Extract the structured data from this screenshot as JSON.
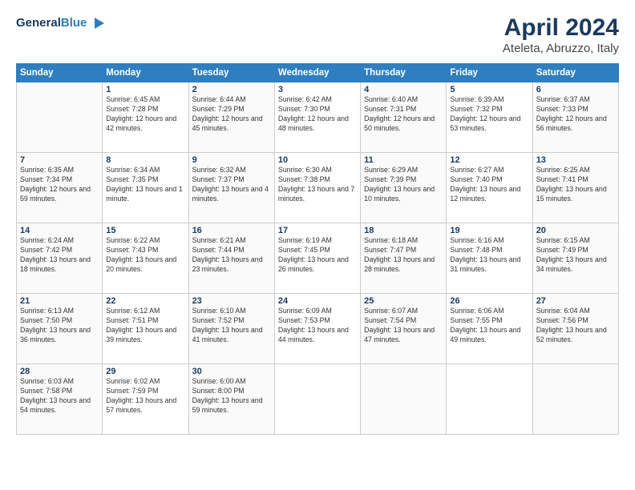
{
  "logo": {
    "line1": "General",
    "line2": "Blue",
    "icon": "▶"
  },
  "title": "April 2024",
  "subtitle": "Ateleta, Abruzzo, Italy",
  "weekdays": [
    "Sunday",
    "Monday",
    "Tuesday",
    "Wednesday",
    "Thursday",
    "Friday",
    "Saturday"
  ],
  "weeks": [
    [
      {
        "day": "",
        "sunrise": "",
        "sunset": "",
        "daylight": ""
      },
      {
        "day": "1",
        "sunrise": "Sunrise: 6:45 AM",
        "sunset": "Sunset: 7:28 PM",
        "daylight": "Daylight: 12 hours and 42 minutes."
      },
      {
        "day": "2",
        "sunrise": "Sunrise: 6:44 AM",
        "sunset": "Sunset: 7:29 PM",
        "daylight": "Daylight: 12 hours and 45 minutes."
      },
      {
        "day": "3",
        "sunrise": "Sunrise: 6:42 AM",
        "sunset": "Sunset: 7:30 PM",
        "daylight": "Daylight: 12 hours and 48 minutes."
      },
      {
        "day": "4",
        "sunrise": "Sunrise: 6:40 AM",
        "sunset": "Sunset: 7:31 PM",
        "daylight": "Daylight: 12 hours and 50 minutes."
      },
      {
        "day": "5",
        "sunrise": "Sunrise: 6:39 AM",
        "sunset": "Sunset: 7:32 PM",
        "daylight": "Daylight: 12 hours and 53 minutes."
      },
      {
        "day": "6",
        "sunrise": "Sunrise: 6:37 AM",
        "sunset": "Sunset: 7:33 PM",
        "daylight": "Daylight: 12 hours and 56 minutes."
      }
    ],
    [
      {
        "day": "7",
        "sunrise": "Sunrise: 6:35 AM",
        "sunset": "Sunset: 7:34 PM",
        "daylight": "Daylight: 12 hours and 59 minutes."
      },
      {
        "day": "8",
        "sunrise": "Sunrise: 6:34 AM",
        "sunset": "Sunset: 7:35 PM",
        "daylight": "Daylight: 13 hours and 1 minute."
      },
      {
        "day": "9",
        "sunrise": "Sunrise: 6:32 AM",
        "sunset": "Sunset: 7:37 PM",
        "daylight": "Daylight: 13 hours and 4 minutes."
      },
      {
        "day": "10",
        "sunrise": "Sunrise: 6:30 AM",
        "sunset": "Sunset: 7:38 PM",
        "daylight": "Daylight: 13 hours and 7 minutes."
      },
      {
        "day": "11",
        "sunrise": "Sunrise: 6:29 AM",
        "sunset": "Sunset: 7:39 PM",
        "daylight": "Daylight: 13 hours and 10 minutes."
      },
      {
        "day": "12",
        "sunrise": "Sunrise: 6:27 AM",
        "sunset": "Sunset: 7:40 PM",
        "daylight": "Daylight: 13 hours and 12 minutes."
      },
      {
        "day": "13",
        "sunrise": "Sunrise: 6:25 AM",
        "sunset": "Sunset: 7:41 PM",
        "daylight": "Daylight: 13 hours and 15 minutes."
      }
    ],
    [
      {
        "day": "14",
        "sunrise": "Sunrise: 6:24 AM",
        "sunset": "Sunset: 7:42 PM",
        "daylight": "Daylight: 13 hours and 18 minutes."
      },
      {
        "day": "15",
        "sunrise": "Sunrise: 6:22 AM",
        "sunset": "Sunset: 7:43 PM",
        "daylight": "Daylight: 13 hours and 20 minutes."
      },
      {
        "day": "16",
        "sunrise": "Sunrise: 6:21 AM",
        "sunset": "Sunset: 7:44 PM",
        "daylight": "Daylight: 13 hours and 23 minutes."
      },
      {
        "day": "17",
        "sunrise": "Sunrise: 6:19 AM",
        "sunset": "Sunset: 7:45 PM",
        "daylight": "Daylight: 13 hours and 26 minutes."
      },
      {
        "day": "18",
        "sunrise": "Sunrise: 6:18 AM",
        "sunset": "Sunset: 7:47 PM",
        "daylight": "Daylight: 13 hours and 28 minutes."
      },
      {
        "day": "19",
        "sunrise": "Sunrise: 6:16 AM",
        "sunset": "Sunset: 7:48 PM",
        "daylight": "Daylight: 13 hours and 31 minutes."
      },
      {
        "day": "20",
        "sunrise": "Sunrise: 6:15 AM",
        "sunset": "Sunset: 7:49 PM",
        "daylight": "Daylight: 13 hours and 34 minutes."
      }
    ],
    [
      {
        "day": "21",
        "sunrise": "Sunrise: 6:13 AM",
        "sunset": "Sunset: 7:50 PM",
        "daylight": "Daylight: 13 hours and 36 minutes."
      },
      {
        "day": "22",
        "sunrise": "Sunrise: 6:12 AM",
        "sunset": "Sunset: 7:51 PM",
        "daylight": "Daylight: 13 hours and 39 minutes."
      },
      {
        "day": "23",
        "sunrise": "Sunrise: 6:10 AM",
        "sunset": "Sunset: 7:52 PM",
        "daylight": "Daylight: 13 hours and 41 minutes."
      },
      {
        "day": "24",
        "sunrise": "Sunrise: 6:09 AM",
        "sunset": "Sunset: 7:53 PM",
        "daylight": "Daylight: 13 hours and 44 minutes."
      },
      {
        "day": "25",
        "sunrise": "Sunrise: 6:07 AM",
        "sunset": "Sunset: 7:54 PM",
        "daylight": "Daylight: 13 hours and 47 minutes."
      },
      {
        "day": "26",
        "sunrise": "Sunrise: 6:06 AM",
        "sunset": "Sunset: 7:55 PM",
        "daylight": "Daylight: 13 hours and 49 minutes."
      },
      {
        "day": "27",
        "sunrise": "Sunrise: 6:04 AM",
        "sunset": "Sunset: 7:56 PM",
        "daylight": "Daylight: 13 hours and 52 minutes."
      }
    ],
    [
      {
        "day": "28",
        "sunrise": "Sunrise: 6:03 AM",
        "sunset": "Sunset: 7:58 PM",
        "daylight": "Daylight: 13 hours and 54 minutes."
      },
      {
        "day": "29",
        "sunrise": "Sunrise: 6:02 AM",
        "sunset": "Sunset: 7:59 PM",
        "daylight": "Daylight: 13 hours and 57 minutes."
      },
      {
        "day": "30",
        "sunrise": "Sunrise: 6:00 AM",
        "sunset": "Sunset: 8:00 PM",
        "daylight": "Daylight: 13 hours and 59 minutes."
      },
      {
        "day": "",
        "sunrise": "",
        "sunset": "",
        "daylight": ""
      },
      {
        "day": "",
        "sunrise": "",
        "sunset": "",
        "daylight": ""
      },
      {
        "day": "",
        "sunrise": "",
        "sunset": "",
        "daylight": ""
      },
      {
        "day": "",
        "sunrise": "",
        "sunset": "",
        "daylight": ""
      }
    ]
  ]
}
